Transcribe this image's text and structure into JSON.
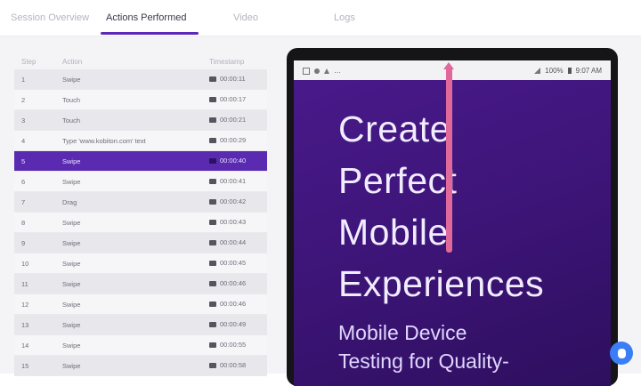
{
  "tabs": [
    {
      "label": "Session Overview"
    },
    {
      "label": "Actions Performed"
    },
    {
      "label": "Video"
    },
    {
      "label": "Logs"
    }
  ],
  "table": {
    "headers": {
      "step": "Step",
      "action": "Action",
      "timestamp": "Timestamp"
    },
    "selected_index": 4,
    "rows": [
      {
        "step": "1",
        "action": "Swipe",
        "timestamp": "00:00:11"
      },
      {
        "step": "2",
        "action": "Touch",
        "timestamp": "00:00:17"
      },
      {
        "step": "3",
        "action": "Touch",
        "timestamp": "00:00:21"
      },
      {
        "step": "4",
        "action": "Type 'www.kobiton.com' text",
        "timestamp": "00:00:29"
      },
      {
        "step": "5",
        "action": "Swipe",
        "timestamp": "00:00:40"
      },
      {
        "step": "6",
        "action": "Swipe",
        "timestamp": "00:00:41"
      },
      {
        "step": "7",
        "action": "Drag",
        "timestamp": "00:00:42"
      },
      {
        "step": "8",
        "action": "Swipe",
        "timestamp": "00:00:43"
      },
      {
        "step": "9",
        "action": "Swipe",
        "timestamp": "00:00:44"
      },
      {
        "step": "10",
        "action": "Swipe",
        "timestamp": "00:00:45"
      },
      {
        "step": "11",
        "action": "Swipe",
        "timestamp": "00:00:46"
      },
      {
        "step": "12",
        "action": "Swipe",
        "timestamp": "00:00:46"
      },
      {
        "step": "13",
        "action": "Swipe",
        "timestamp": "00:00:49"
      },
      {
        "step": "14",
        "action": "Swipe",
        "timestamp": "00:00:55"
      },
      {
        "step": "15",
        "action": "Swipe",
        "timestamp": "00:00:58"
      }
    ]
  },
  "device": {
    "status": {
      "battery": "100%",
      "time": "9:07 AM"
    },
    "headline": [
      "Create",
      "Perfect",
      "Mobile",
      "Experiences"
    ],
    "subline": [
      "Mobile Device",
      "Testing for Quality-"
    ]
  },
  "colors": {
    "accent": "#5b2bb7",
    "selected_row": "#5a2bb0",
    "swipe_indicator": "#e0689a",
    "help_button": "#3b7df5"
  },
  "icons": [
    "video-icon",
    "swipe-arrow-icon",
    "help-chat-icon"
  ]
}
